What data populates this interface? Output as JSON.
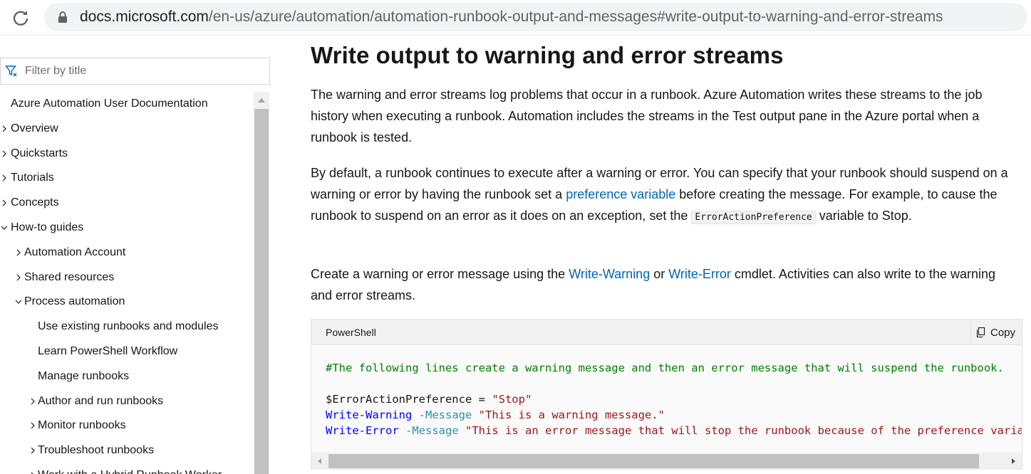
{
  "browser": {
    "url_host": "docs.microsoft.com",
    "url_path": "/en-us/azure/automation/automation-runbook-output-and-messages#write-output-to-warning-and-error-streams"
  },
  "sidebar": {
    "filter_placeholder": "Filter by title",
    "items": [
      {
        "label": "Azure Automation User Documentation",
        "chevron": "none",
        "level": 0
      },
      {
        "label": "Overview",
        "chevron": "right",
        "level": 0
      },
      {
        "label": "Quickstarts",
        "chevron": "right",
        "level": 0
      },
      {
        "label": "Tutorials",
        "chevron": "right",
        "level": 0
      },
      {
        "label": "Concepts",
        "chevron": "right",
        "level": 0
      },
      {
        "label": "How-to guides",
        "chevron": "down",
        "level": 0
      },
      {
        "label": "Automation Account",
        "chevron": "right",
        "level": 1
      },
      {
        "label": "Shared resources",
        "chevron": "right",
        "level": 1
      },
      {
        "label": "Process automation",
        "chevron": "down",
        "level": 1
      },
      {
        "label": "Use existing runbooks and modules",
        "chevron": "none",
        "level": 2
      },
      {
        "label": "Learn PowerShell Workflow",
        "chevron": "none",
        "level": 2
      },
      {
        "label": "Manage runbooks",
        "chevron": "none",
        "level": 2
      },
      {
        "label": "Author and run runbooks",
        "chevron": "right",
        "level": 2
      },
      {
        "label": "Monitor runbooks",
        "chevron": "right",
        "level": 2
      },
      {
        "label": "Troubleshoot runbooks",
        "chevron": "right",
        "level": 2
      },
      {
        "label": "Work with a Hybrid Runbook Worker",
        "chevron": "right",
        "level": 2
      }
    ]
  },
  "article": {
    "heading": "Write output to warning and error streams",
    "p1": "The warning and error streams log problems that occur in a runbook. Azure Automation writes these streams to the job history when executing a runbook. Automation includes the streams in the Test output pane in the Azure portal when a runbook is tested.",
    "p2_a": "By default, a runbook continues to execute after a warning or error. You can specify that your runbook should suspend on a warning or error by having the runbook set a ",
    "p2_link": "preference variable",
    "p2_b": " before creating the message. For example, to cause the runbook to suspend on an error as it does on an exception, set the ",
    "p2_code": "ErrorActionPreference",
    "p2_c": " variable to Stop.",
    "p3_a": "Create a warning or error message using the ",
    "p3_link1": "Write-Warning",
    "p3_or": " or ",
    "p3_link2": "Write-Error",
    "p3_b": " cmdlet. Activities can also write to the warning and error streams."
  },
  "code": {
    "language": "PowerShell",
    "copy_label": "Copy",
    "comment": "#The following lines create a warning message and then an error message that will suspend the runbook.",
    "line2_var": "$ErrorActionPreference",
    "line2_eq": " = ",
    "line2_str": "\"Stop\"",
    "line3_cmd": "Write-Warning",
    "line3_param": "-Message",
    "line3_str": "\"This is a warning message.\"",
    "line4_cmd": "Write-Error",
    "line4_param": "-Message",
    "line4_str": "\"This is an error message that will stop the runbook because of the preference variable setting.\""
  },
  "colors": {
    "link": "#0065b3",
    "comment": "#008000",
    "string": "#a31515",
    "cmdlet": "#0000ff",
    "parameter": "#2b91af"
  }
}
